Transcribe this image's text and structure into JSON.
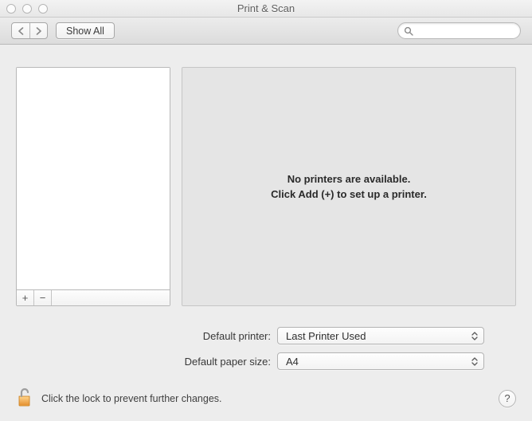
{
  "window": {
    "title": "Print & Scan"
  },
  "toolbar": {
    "show_all_label": "Show All",
    "search_placeholder": ""
  },
  "sidebar": {
    "add_button_glyph": "+",
    "remove_button_glyph": "−"
  },
  "detail": {
    "line1": "No printers are available.",
    "line2": "Click Add (+) to set up a printer."
  },
  "form": {
    "default_printer_label": "Default printer:",
    "default_printer_value": "Last Printer Used",
    "default_paper_label": "Default paper size:",
    "default_paper_value": "A4"
  },
  "footer": {
    "lock_text": "Click the lock to prevent further changes.",
    "help_glyph": "?"
  }
}
